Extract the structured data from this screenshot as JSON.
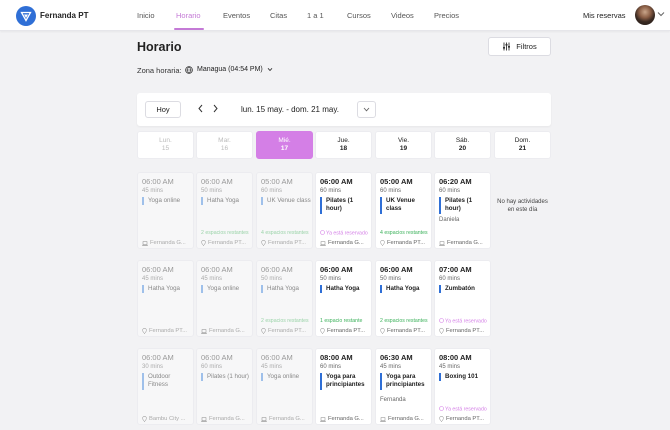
{
  "app": {
    "brand": "Fernanda PT",
    "colors": {
      "accent": "#d47fe6",
      "brand": "#2f6fd6",
      "green": "#3bb15a"
    }
  },
  "nav": {
    "items": [
      {
        "label": "Inicio",
        "active": false
      },
      {
        "label": "Horario",
        "active": true
      },
      {
        "label": "Eventos",
        "active": false
      },
      {
        "label": "Citas",
        "active": false
      },
      {
        "label": "1 a 1",
        "active": false
      },
      {
        "label": "Cursos",
        "active": false
      },
      {
        "label": "Videos",
        "active": false
      },
      {
        "label": "Precios",
        "active": false
      }
    ],
    "reservas": "Mis reservas"
  },
  "page": {
    "title": "Horario",
    "filtros": "Filtros",
    "tz_label": "Zona horaria:",
    "tz_value": "Managua (04:54 PM)"
  },
  "week": {
    "hoy": "Hoy",
    "range": "lun. 15 may. - dom. 21 may."
  },
  "days": [
    {
      "name": "Lun.",
      "date": "15",
      "state": "past"
    },
    {
      "name": "Mar.",
      "date": "16",
      "state": "past"
    },
    {
      "name": "Mié.",
      "date": "17",
      "state": "today"
    },
    {
      "name": "Jue.",
      "date": "18",
      "state": "future"
    },
    {
      "name": "Vie.",
      "date": "19",
      "state": "future"
    },
    {
      "name": "Sáb.",
      "date": "20",
      "state": "future"
    },
    {
      "name": "Dom.",
      "date": "21",
      "state": "future"
    }
  ],
  "empty_day": "No hay actividades en este día",
  "sessions": [
    [
      {
        "time": "06:00 AM",
        "duration": "45 mins",
        "name": "Yoga online",
        "instructor": "",
        "status": "",
        "status_type": "",
        "location": "Fernanda G...",
        "loc_type": "online",
        "past": true
      },
      {
        "time": "06:00 AM",
        "duration": "45 mins",
        "name": "Hatha Yoga",
        "instructor": "",
        "status": "",
        "status_type": "",
        "location": "Fernanda PT...",
        "loc_type": "place",
        "past": true
      },
      {
        "time": "06:00 AM",
        "duration": "30 mins",
        "name": "Outdoor Fitness",
        "instructor": "",
        "status": "",
        "status_type": "",
        "location": "Bambu City ...",
        "loc_type": "place",
        "past": true
      }
    ],
    [
      {
        "time": "06:00 AM",
        "duration": "50 mins",
        "name": "Hatha Yoga",
        "instructor": "",
        "status": "2 espacios restantes",
        "status_type": "green",
        "location": "Fernanda PT...",
        "loc_type": "place",
        "past": true
      },
      {
        "time": "06:00 AM",
        "duration": "45 mins",
        "name": "Yoga online",
        "instructor": "",
        "status": "",
        "status_type": "",
        "location": "Fernanda G...",
        "loc_type": "online",
        "past": true
      },
      {
        "time": "06:00 AM",
        "duration": "60 mins",
        "name": "Pilates (1 hour)",
        "instructor": "",
        "status": "",
        "status_type": "",
        "location": "Fernanda G...",
        "loc_type": "online",
        "past": true
      }
    ],
    [
      {
        "time": "05:00 AM",
        "duration": "60 mins",
        "name": "UK Venue class",
        "instructor": "",
        "status": "4 espacios restantes",
        "status_type": "green",
        "location": "Fernanda PT...",
        "loc_type": "place",
        "past": true
      },
      {
        "time": "06:00 AM",
        "duration": "50 mins",
        "name": "Hatha Yoga",
        "instructor": "",
        "status": "2 espacios restantes",
        "status_type": "green",
        "location": "Fernanda PT...",
        "loc_type": "place",
        "past": true
      },
      {
        "time": "06:00 AM",
        "duration": "45 mins",
        "name": "Yoga online",
        "instructor": "",
        "status": "",
        "status_type": "",
        "location": "Fernanda G...",
        "loc_type": "online",
        "past": true
      }
    ],
    [
      {
        "time": "06:00 AM",
        "duration": "60 mins",
        "name": "Pilates (1 hour)",
        "instructor": "",
        "status": "Ya está reservado",
        "status_type": "pink",
        "location": "Fernanda G...",
        "loc_type": "online",
        "past": false
      },
      {
        "time": "06:00 AM",
        "duration": "50 mins",
        "name": "Hatha Yoga",
        "instructor": "",
        "status": "1 espacio restante",
        "status_type": "green",
        "location": "Fernanda PT...",
        "loc_type": "place",
        "past": false
      },
      {
        "time": "08:00 AM",
        "duration": "60 mins",
        "name": "Yoga para principiantes",
        "instructor": "",
        "status": "",
        "status_type": "",
        "location": "Fernanda G...",
        "loc_type": "online",
        "past": false
      }
    ],
    [
      {
        "time": "05:00 AM",
        "duration": "60 mins",
        "name": "UK Venue class",
        "instructor": "",
        "status": "4 espacios restantes",
        "status_type": "green",
        "location": "Fernanda PT...",
        "loc_type": "place",
        "past": false
      },
      {
        "time": "06:00 AM",
        "duration": "50 mins",
        "name": "Hatha Yoga",
        "instructor": "",
        "status": "2 espacios restantes",
        "status_type": "green",
        "location": "Fernanda PT...",
        "loc_type": "place",
        "past": false
      },
      {
        "time": "06:30 AM",
        "duration": "45 mins",
        "name": "Yoga para principiantes",
        "instructor": "Fernanda",
        "status": "",
        "status_type": "",
        "location": "Fernanda G...",
        "loc_type": "online",
        "past": false
      }
    ],
    [
      {
        "time": "06:20 AM",
        "duration": "60 mins",
        "name": "Pilates (1 hour)",
        "instructor": "Daniela",
        "status": "",
        "status_type": "",
        "location": "Fernanda G...",
        "loc_type": "online",
        "past": false
      },
      {
        "time": "07:00 AM",
        "duration": "60 mins",
        "name": "Zumbatón",
        "instructor": "",
        "status": "Ya está reservado",
        "status_type": "pink",
        "location": "Fernanda PT...",
        "loc_type": "place",
        "past": false
      },
      {
        "time": "08:00 AM",
        "duration": "45 mins",
        "name": "Boxing 101",
        "instructor": "",
        "status": "Ya está reservado",
        "status_type": "pink",
        "location": "Fernanda PT...",
        "loc_type": "place",
        "past": false
      }
    ],
    []
  ]
}
